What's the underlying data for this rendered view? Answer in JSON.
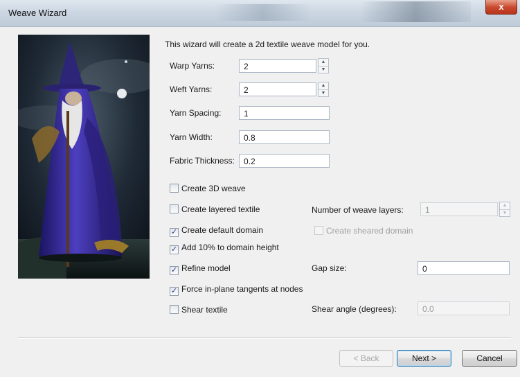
{
  "window": {
    "title": "Weave Wizard",
    "close_label": "x"
  },
  "intro": "This wizard will create a 2d textile weave model for you.",
  "fields": {
    "warp_yarns": {
      "label": "Warp Yarns:",
      "value": "2"
    },
    "weft_yarns": {
      "label": "Weft Yarns:",
      "value": "2"
    },
    "yarn_spacing": {
      "label": "Yarn Spacing:",
      "value": "1"
    },
    "yarn_width": {
      "label": "Yarn Width:",
      "value": "0.8"
    },
    "fabric_thickness": {
      "label": "Fabric Thickness:",
      "value": "0.2"
    }
  },
  "checkboxes": {
    "create_3d_weave": {
      "label": "Create 3D weave",
      "checked": false
    },
    "create_layered_textile": {
      "label": "Create layered textile",
      "checked": false
    },
    "create_default_domain": {
      "label": "Create default domain",
      "checked": true
    },
    "add_10_percent": {
      "label": "Add 10% to domain height",
      "checked": true
    },
    "refine_model": {
      "label": "Refine model",
      "checked": true
    },
    "force_tangents": {
      "label": "Force in-plane tangents at nodes",
      "checked": true
    },
    "shear_textile": {
      "label": "Shear textile",
      "checked": false
    },
    "create_sheared_domain": {
      "label": "Create sheared domain",
      "checked": false,
      "disabled": true
    }
  },
  "right_options": {
    "weave_layers": {
      "label": "Number of weave layers:",
      "value": "1",
      "disabled": true
    },
    "gap_size": {
      "label": "Gap size:",
      "value": "0"
    },
    "shear_angle": {
      "label": "Shear angle (degrees):",
      "value": "0.0",
      "disabled": true
    }
  },
  "buttons": {
    "back": "< Back",
    "next": "Next >",
    "cancel": "Cancel"
  },
  "colors": {
    "robe": "#3a2f9c",
    "checkmark": "#2a3a8a",
    "default_button_border": "#3c7fb1"
  }
}
